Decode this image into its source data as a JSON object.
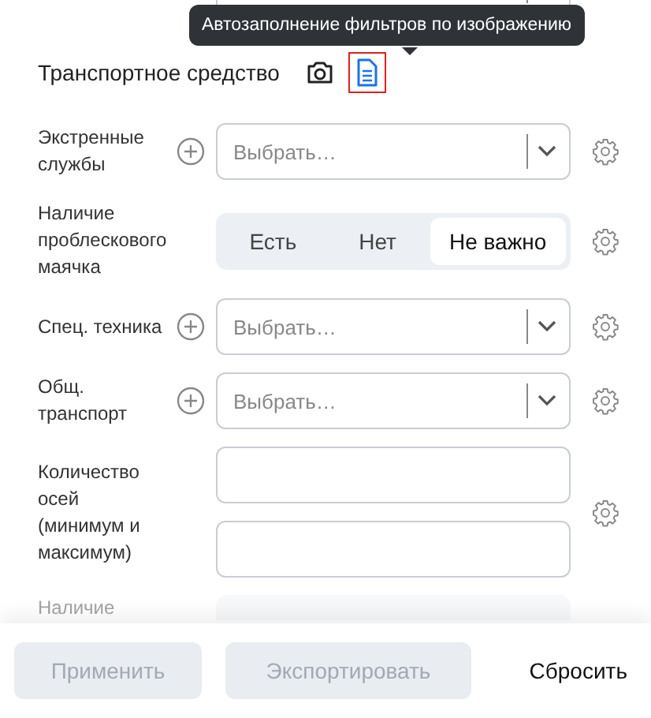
{
  "tooltip": {
    "text": "Автозаполнение фильтров по изображению"
  },
  "section": {
    "title": "Транспортное средство"
  },
  "fields": [
    {
      "kind": "select",
      "label": "Экстренные службы",
      "placeholder": "Выбрать…"
    },
    {
      "kind": "toggle",
      "label": "Наличие проблескового маячка",
      "options": [
        {
          "label": "Есть",
          "selected": false
        },
        {
          "label": "Нет",
          "selected": false
        },
        {
          "label": "Не важно",
          "selected": true
        }
      ]
    },
    {
      "kind": "select",
      "label": "Спец. техника",
      "placeholder": "Выбрать…"
    },
    {
      "kind": "select",
      "label": "Общ. транспорт",
      "placeholder": "Выбрать…"
    },
    {
      "kind": "range",
      "label": "Количество осей (минимум и максимум)"
    },
    {
      "kind": "toggle_cut",
      "label": "Наличие"
    }
  ],
  "footer": {
    "buttons": [
      {
        "label": "Применить",
        "kind": "filled",
        "disabled": true
      },
      {
        "label": "Экспортировать",
        "kind": "filled",
        "disabled": true
      },
      {
        "label": "Сбросить",
        "kind": "plain",
        "disabled": false
      }
    ]
  }
}
